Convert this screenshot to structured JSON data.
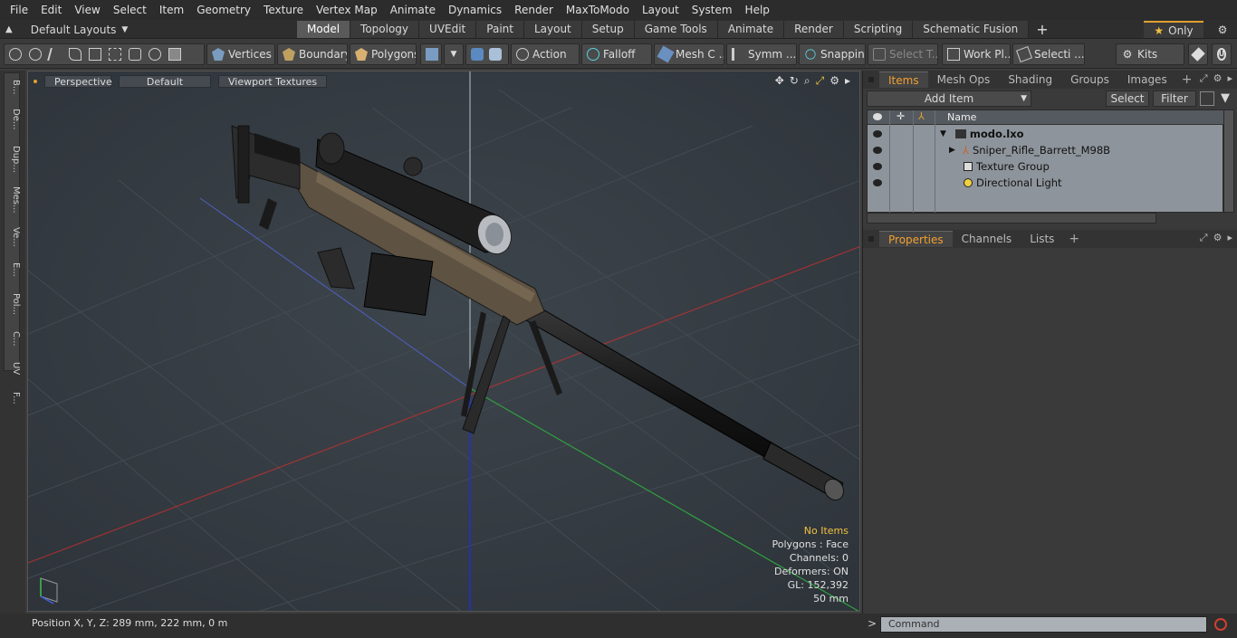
{
  "menu": [
    "File",
    "Edit",
    "View",
    "Select",
    "Item",
    "Geometry",
    "Texture",
    "Vertex Map",
    "Animate",
    "Dynamics",
    "Render",
    "MaxToModo",
    "Layout",
    "System",
    "Help"
  ],
  "layout": {
    "title": "Default Layouts",
    "tabs": [
      "Model",
      "Topology",
      "UVEdit",
      "Paint",
      "Layout",
      "Setup",
      "Game Tools",
      "Animate",
      "Render",
      "Scripting",
      "Schematic Fusion"
    ],
    "active_tab": "Model",
    "only_label": "Only"
  },
  "toolbar": {
    "vertices": "Vertices",
    "boundary": "Boundary",
    "polygons": "Polygons",
    "action": "Action",
    "falloff": "Falloff",
    "mesh": "Mesh C ...",
    "symm": "Symm ...",
    "snapping": "Snapping",
    "select_t": "Select T...",
    "work": "Work Pl...",
    "selecti": "Selecti ...",
    "kits": "Kits"
  },
  "left_tabs": [
    "B...",
    "De...",
    "Dup...",
    "Mes...",
    "Ve...",
    "E...",
    "Pol...",
    "C...",
    "UV",
    "F..."
  ],
  "viewport": {
    "perspective": "Perspective",
    "default": "Default",
    "textures": "Viewport Textures",
    "hud": {
      "status": "No Items",
      "polygons": "Polygons : Face",
      "channels": "Channels: 0",
      "deformers": "Deformers: ON",
      "gl": "GL: 152,392",
      "scale": "50 mm"
    }
  },
  "status": {
    "position": "Position X, Y, Z:   289 mm, 222 mm, 0 m"
  },
  "panel": {
    "tabs": [
      "Items",
      "Mesh Ops",
      "Shading",
      "Groups",
      "Images"
    ],
    "active_tab": "Items",
    "add_item": "Add Item",
    "select": "Select",
    "filter": "Filter",
    "name_col": "Name",
    "items": [
      {
        "label": "modo.lxo"
      },
      {
        "label": "Sniper_Rifle_Barrett_M98B"
      },
      {
        "label": "Texture Group"
      },
      {
        "label": "Directional Light"
      }
    ],
    "prop_tabs": [
      "Properties",
      "Channels",
      "Lists"
    ],
    "active_prop": "Properties"
  },
  "command": {
    "placeholder": "Command"
  },
  "colors": {
    "accent": "#f2a030",
    "viewport_bg": "#353c43",
    "x_axis": "#c83030",
    "y_axis": "#30a040",
    "z_axis": "#3040c8"
  }
}
